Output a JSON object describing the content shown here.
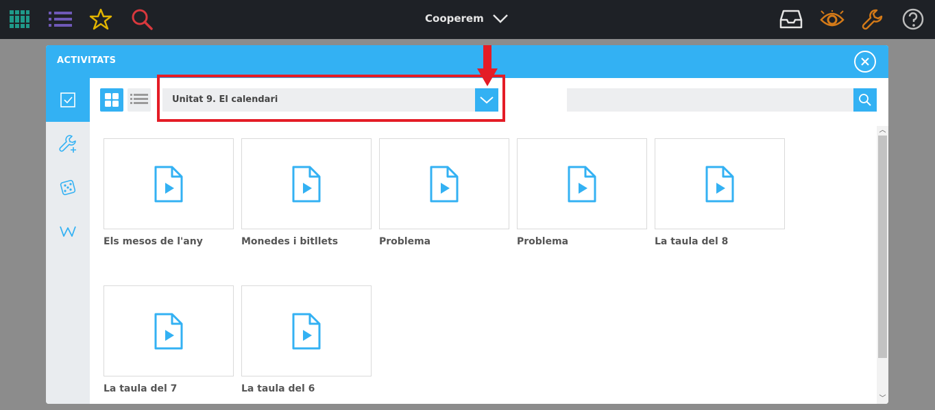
{
  "topbar": {
    "book_title": "Cooperem",
    "icons": [
      "library-icon",
      "list-icon",
      "star-icon",
      "search-icon",
      "inbox-icon",
      "eye-icon",
      "wrench-icon",
      "help-icon"
    ]
  },
  "modal": {
    "title": "ACTIVITATS",
    "unit_select": {
      "value": "Unitat 9. El calendari"
    },
    "search": {
      "value": ""
    },
    "sidebar": [
      "activities-icon",
      "tools-icon",
      "dice-icon",
      "w-icon"
    ],
    "activities": [
      {
        "title": "Els mesos de l'any"
      },
      {
        "title": "Monedes i bitllets"
      },
      {
        "title": "Problema"
      },
      {
        "title": "Problema"
      },
      {
        "title": "La taula del 8"
      },
      {
        "title": "La taula del 7"
      },
      {
        "title": "La taula del 6"
      }
    ]
  },
  "colors": {
    "accent": "#33b1f3",
    "highlight": "#e41c26",
    "topbar": "#1e2126"
  }
}
